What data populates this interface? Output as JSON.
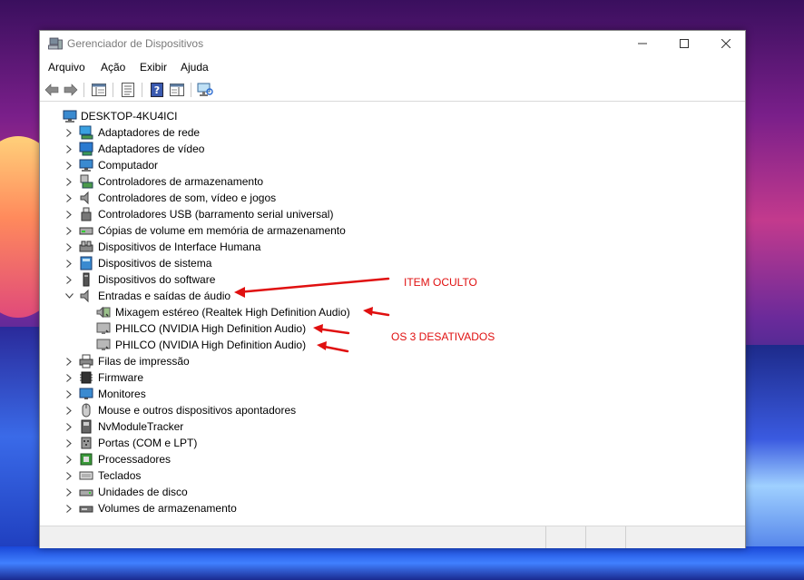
{
  "window": {
    "title": "Gerenciador de Dispositivos"
  },
  "menu": [
    {
      "label": "Arquivo"
    },
    {
      "label": "Ação"
    },
    {
      "label": "Exibir"
    },
    {
      "label": "Ajuda"
    }
  ],
  "tree": {
    "root": "DESKTOP-4KU4ICI",
    "categories": [
      {
        "label": "Adaptadores de rede",
        "icon": "network-adapter-icon"
      },
      {
        "label": "Adaptadores de vídeo",
        "icon": "display-adapter-icon"
      },
      {
        "label": "Computador",
        "icon": "computer-icon"
      },
      {
        "label": "Controladores de armazenamento",
        "icon": "storage-controller-icon"
      },
      {
        "label": "Controladores de som, vídeo e jogos",
        "icon": "speaker-icon"
      },
      {
        "label": "Controladores USB (barramento serial universal)",
        "icon": "usb-icon"
      },
      {
        "label": "Cópias de volume em memória de armazenamento",
        "icon": "drive-icon"
      },
      {
        "label": "Dispositivos de Interface Humana",
        "icon": "hid-icon"
      },
      {
        "label": "Dispositivos de sistema",
        "icon": "system-device-icon"
      },
      {
        "label": "Dispositivos do software",
        "icon": "software-device-icon"
      },
      {
        "label": "Entradas e saídas de áudio",
        "icon": "speaker-icon",
        "expanded": true,
        "children": [
          {
            "label": "Mixagem estéreo (Realtek High Definition Audio)",
            "icon": "audio-device-disabled-icon"
          },
          {
            "label": "PHILCO (NVIDIA High Definition Audio)",
            "icon": "monitor-disabled-icon"
          },
          {
            "label": "PHILCO (NVIDIA High Definition Audio)",
            "icon": "monitor-disabled-icon"
          }
        ]
      },
      {
        "label": "Filas de impressão",
        "icon": "printer-icon"
      },
      {
        "label": "Firmware",
        "icon": "firmware-icon"
      },
      {
        "label": "Monitores",
        "icon": "monitor-icon"
      },
      {
        "label": "Mouse e outros dispositivos apontadores",
        "icon": "mouse-icon"
      },
      {
        "label": "NvModuleTracker",
        "icon": "nvmodule-icon"
      },
      {
        "label": "Portas (COM e LPT)",
        "icon": "port-icon"
      },
      {
        "label": "Processadores",
        "icon": "processor-icon"
      },
      {
        "label": "Teclados",
        "icon": "keyboard-icon"
      },
      {
        "label": "Unidades de disco",
        "icon": "disk-drive-icon"
      },
      {
        "label": "Volumes de armazenamento",
        "icon": "storage-volume-icon"
      }
    ]
  },
  "annotations": {
    "hidden_item": "ITEM OCULTO",
    "disabled_items": "OS 3 DESATIVADOS"
  },
  "colors": {
    "annotation": "#e01010",
    "title_text": "#7a7a7a"
  }
}
